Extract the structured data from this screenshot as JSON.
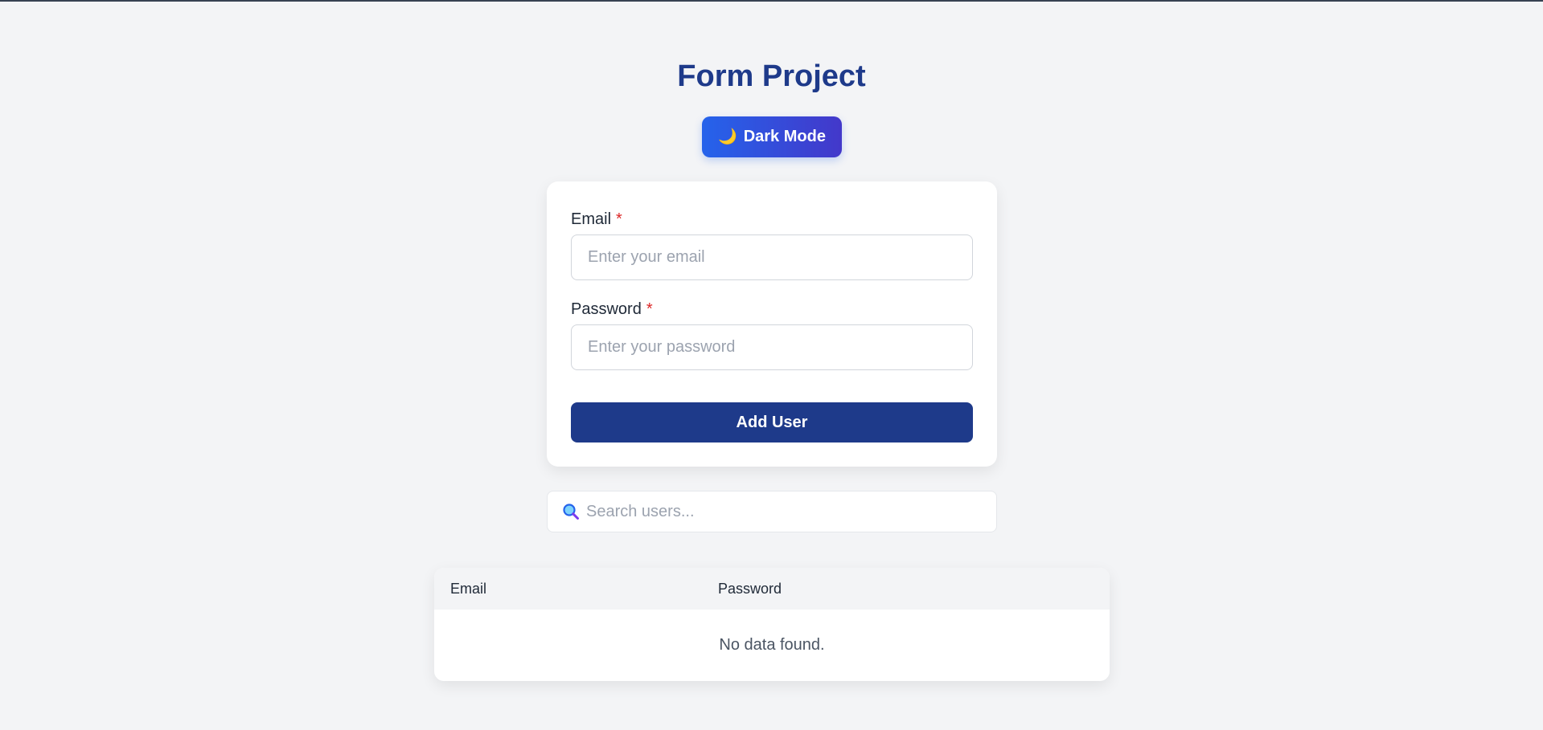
{
  "header": {
    "title": "Form Project"
  },
  "theme_toggle": {
    "icon": "moon-icon",
    "label": "Dark Mode"
  },
  "form": {
    "email_label": "Email",
    "email_placeholder": "Enter your email",
    "email_value": "",
    "password_label": "Password",
    "password_placeholder": "Enter your password",
    "password_value": "",
    "required_mark": "*",
    "submit_label": "Add User"
  },
  "search": {
    "icon": "search-icon",
    "placeholder": "Search users...",
    "value": ""
  },
  "table": {
    "columns": [
      "Email",
      "Password"
    ],
    "rows": [],
    "empty_text": "No data found."
  },
  "colors": {
    "background": "#f3f4f6",
    "title": "#1e3a8a",
    "primary_button": "#1e3a8a",
    "toggle_gradient_start": "#2563eb",
    "toggle_gradient_end": "#4338ca",
    "required": "#dc2626"
  }
}
